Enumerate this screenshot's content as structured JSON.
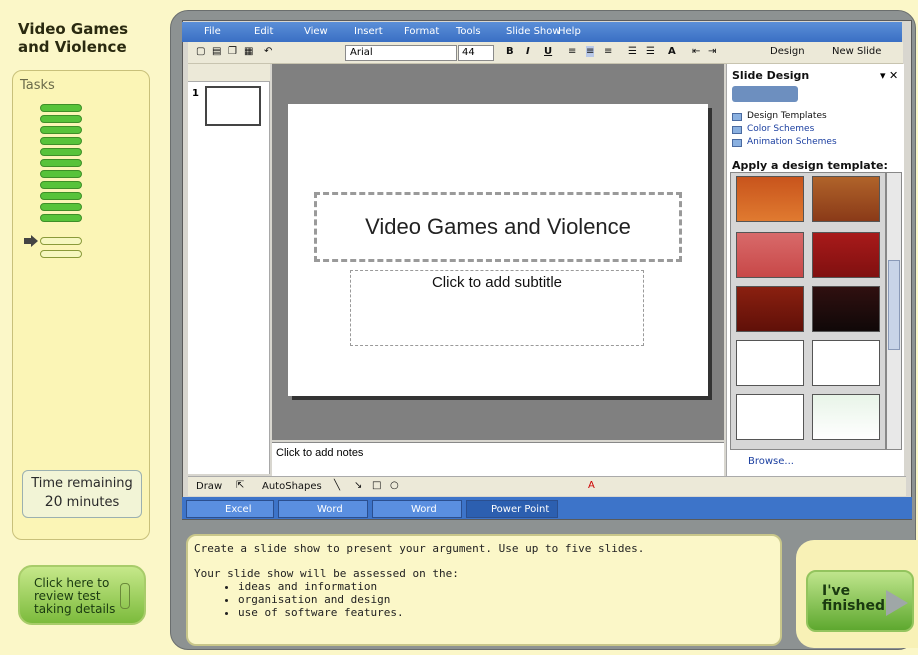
{
  "test": {
    "title": "Video Games and Violence",
    "tasks_label": "Tasks",
    "time_remaining_label": "Time remaining",
    "time_remaining_value": "20",
    "time_remaining_unit": "minutes",
    "review_button": "Click here to review test taking details",
    "finish_button": "I've finished"
  },
  "app": {
    "menu": [
      "File",
      "Edit",
      "View",
      "Insert",
      "Format",
      "Tools",
      "Slide Show",
      "Help"
    ],
    "font_name": "Arial",
    "font_size": "44",
    "toolbar_buttons": [
      "B",
      "I",
      "U",
      "Design",
      "New Slide"
    ],
    "slide_number": "1",
    "slide_title": "Video Games and Violence",
    "slide_subtitle": "Click to add subtitle",
    "notes_placeholder": "Click to add notes",
    "task_pane": {
      "title": "Slide Design",
      "links": [
        "Design Templates",
        "Color Schemes",
        "Animation Schemes"
      ],
      "apply_heading": "Apply a design template:",
      "browse": "Browse..."
    },
    "draw_toolbar": {
      "draw": "Draw",
      "autoshapes": "AutoShapes"
    },
    "taskbar": [
      "Excel",
      "Word",
      "Word",
      "Power Point"
    ]
  },
  "instructions": {
    "line1": "Create a slide show to present your argument. Use up to five slides.",
    "line2": "Your slide show will be assessed on the:",
    "bullets": [
      "ideas and information",
      "organisation and design",
      "use of software features."
    ]
  },
  "progress": {
    "completed_tasks": 11,
    "current_task": 12,
    "total_tasks": 13
  },
  "colors": {
    "accent_green": "#57c33a",
    "app_blue": "#3d74c9"
  }
}
